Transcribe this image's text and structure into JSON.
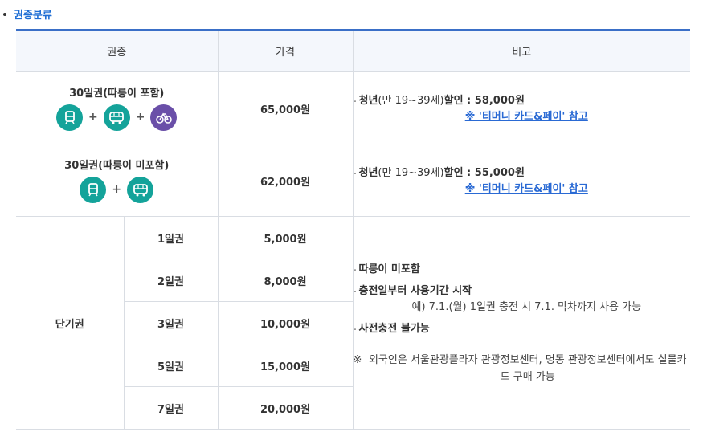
{
  "section": {
    "title": "권종분류"
  },
  "headers": [
    "권종",
    "가격",
    "비고"
  ],
  "row_30_incl": {
    "name": "30일권(따릉이 포함)",
    "price": "65,000원",
    "note_dash": "-",
    "note_bold1": "청년",
    "note_mid": "(만 19~39세)",
    "note_bold2": "할인 : 58,000원",
    "link": "※ '티머니 카드&페이' 참고",
    "icons": [
      "subway-icon",
      "bus-icon",
      "bike-icon"
    ],
    "plus": "+"
  },
  "row_30_excl": {
    "name": "30일권(따릉이 미포함)",
    "price": "62,000원",
    "note_dash": "-",
    "note_bold1": "청년",
    "note_mid": "(만 19~39세)",
    "note_bold2": "할인 : 55,000원",
    "link": "※ '티머니 카드&페이' 참고",
    "icons": [
      "subway-icon",
      "bus-icon"
    ],
    "plus": "+"
  },
  "short_term": {
    "label": "단기권",
    "rows": [
      {
        "days": "1일권",
        "price": "5,000원"
      },
      {
        "days": "2일권",
        "price": "8,000원"
      },
      {
        "days": "3일권",
        "price": "10,000원"
      },
      {
        "days": "5일권",
        "price": "15,000원"
      },
      {
        "days": "7일권",
        "price": "20,000원"
      }
    ],
    "notes": {
      "dash": "-",
      "item1": "따릉이 미포함",
      "item2": "충전일부터 사용기간 시작",
      "item2_sub": "예) 7.1.(월) 1일권 충전 시 7.1. 막차까지 사용 가능",
      "item3": "사전충전 불가능",
      "ref_mark": "※",
      "ref_text": "외국인은 서울관광플라자 관광정보센터, 명동 관광정보센터에서도 실물카드 구매 가능"
    }
  },
  "colors": {
    "accent": "#1f6ed4",
    "teal": "#14a39a",
    "purple": "#6a4fa8",
    "link": "#2a6ad4"
  }
}
